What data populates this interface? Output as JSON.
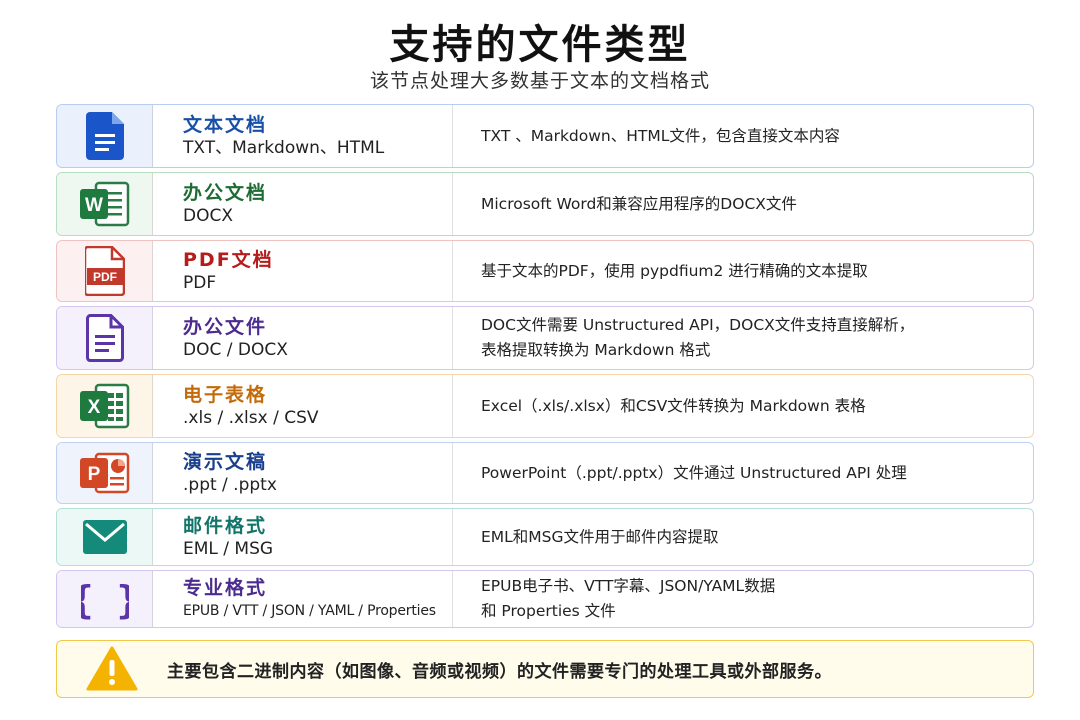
{
  "header": {
    "title": "支持的文件类型",
    "subtitle": "该节点处理大多数基于文本的文档格式"
  },
  "rows": [
    {
      "name": "文本文档",
      "ext": "TXT、Markdown、HTML",
      "desc": [
        "TXT 、Markdown、HTML文件，包含直接文本内容"
      ],
      "icon": "text-document-icon",
      "accent": "#1a4fa8",
      "border": "#b9cdf0",
      "bg": "#eaf1fd"
    },
    {
      "name": "办公文档",
      "ext": "DOCX",
      "desc": [
        "Microsoft Word和兼容应用程序的DOCX文件"
      ],
      "icon": "word-icon",
      "accent": "#1e6b34",
      "border": "#b8dcc0",
      "bg": "#eef7f0"
    },
    {
      "name": "PDF文档",
      "ext": "PDF",
      "desc": [
        "基于文本的PDF，使用 pypdfium2 进行精确的文本提取"
      ],
      "icon": "pdf-icon",
      "accent": "#b51c1c",
      "border": "#efc2c2",
      "bg": "#fdf0f0"
    },
    {
      "name": "办公文件",
      "ext": "DOC / DOCX",
      "desc": [
        "DOC文件需要 Unstructured API，DOCX文件支持直接解析，",
        "表格提取转换为 Markdown 格式"
      ],
      "icon": "document-icon",
      "accent": "#4b2b8f",
      "border": "#d3c7ee",
      "bg": "#f4f0fc"
    },
    {
      "name": "电子表格",
      "ext": ".xls / .xlsx / CSV",
      "desc": [
        "Excel（.xls/.xlsx）和CSV文件转换为 Markdown 表格"
      ],
      "icon": "excel-icon",
      "accent": "#c46a08",
      "border": "#f2d6aa",
      "bg": "#fdf5e8"
    },
    {
      "name": "演示文稿",
      "ext": ".ppt / .pptx",
      "desc": [
        "PowerPoint（.ppt/.pptx）文件通过 Unstructured API 处理"
      ],
      "icon": "powerpoint-icon",
      "accent": "#1a3f8c",
      "border": "#bfd1ef",
      "bg": "#eef3fc"
    },
    {
      "name": "邮件格式",
      "ext": "EML / MSG",
      "desc": [
        "EML和MSG文件用于邮件内容提取"
      ],
      "icon": "mail-icon",
      "accent": "#11756a",
      "border": "#b5e0da",
      "bg": "#ecf8f6"
    },
    {
      "name": "专业格式",
      "ext": "EPUB / VTT / JSON / YAML / Properties",
      "desc": [
        "EPUB电子书、VTT字幕、JSON/YAML数据",
        "和 Properties 文件"
      ],
      "icon": "braces-icon",
      "accent": "#4b2b8f",
      "border": "#d3c7ee",
      "bg": "#f4f0fc"
    }
  ],
  "warning": {
    "text": "主要包含二进制内容（如图像、音频或视频）的文件需要专门的处理工具或外部服务。",
    "icon": "warning-icon"
  }
}
